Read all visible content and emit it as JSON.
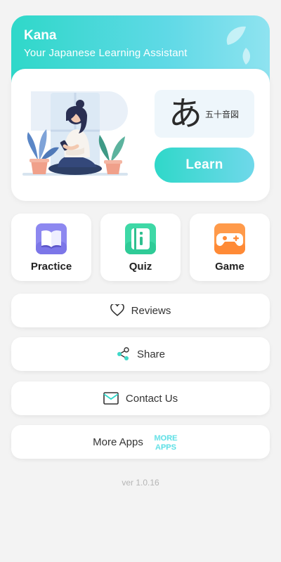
{
  "header": {
    "title": "Kana",
    "subtitle": "Your Japanese Learning Assistant"
  },
  "hero": {
    "kana_char": "あ",
    "kana_label": "五十音図",
    "learn_label": "Learn"
  },
  "tiles": [
    {
      "label": "Practice",
      "icon": "book-icon",
      "color": "#8d88f0"
    },
    {
      "label": "Quiz",
      "icon": "notebook-icon",
      "color": "#3ed8a6"
    },
    {
      "label": "Game",
      "icon": "gamepad-icon",
      "color": "#ff9a4a"
    }
  ],
  "menu": {
    "reviews_label": "Reviews",
    "share_label": "Share",
    "contact_label": "Contact Us",
    "more_apps_label": "More Apps",
    "more_badge_text": [
      "MORE",
      "APPS"
    ]
  },
  "footer": {
    "version": "ver 1.0.16"
  },
  "colors": {
    "accent": "#2fd8c9",
    "background": "#f3f3f3"
  }
}
